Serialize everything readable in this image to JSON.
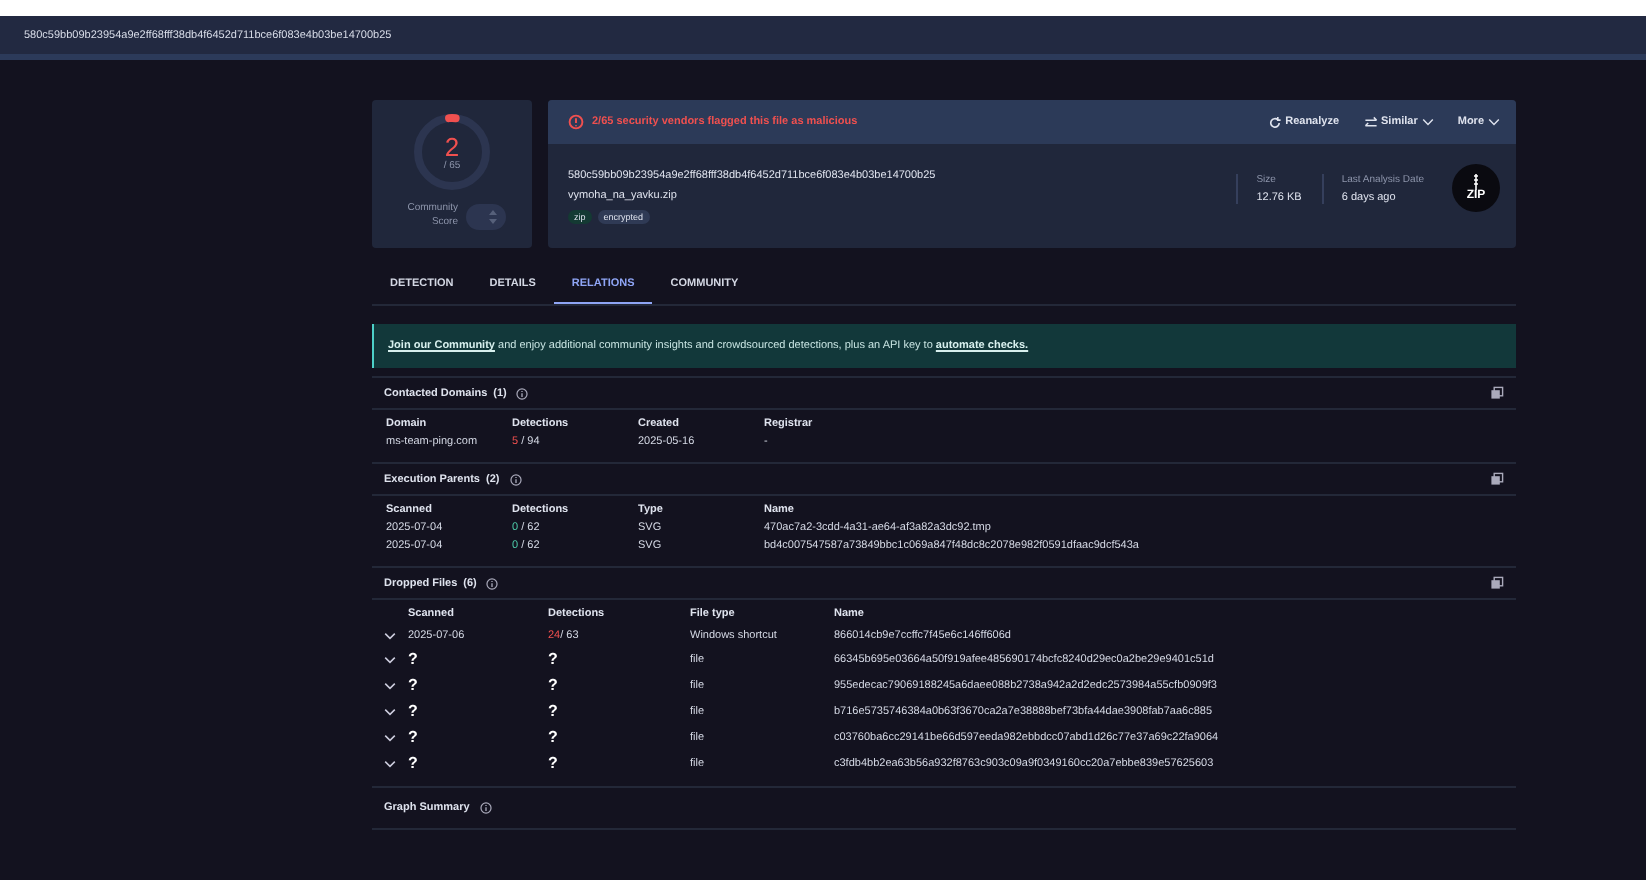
{
  "top_bar": {
    "hash": "580c59bb09b23954a9e2ff68fff38db4f6452d711bce6f083e4b03be14700b25"
  },
  "score": {
    "value": "2",
    "total": "/ 65",
    "label": "Community Score"
  },
  "alert": {
    "text": "2/65 security vendors flagged this file as malicious"
  },
  "actions": [
    {
      "label": "Reanalyze",
      "kind": "reanalyze"
    },
    {
      "label": "Similar",
      "kind": "similar"
    },
    {
      "label": "More",
      "kind": "more"
    }
  ],
  "file": {
    "hash": "580c59bb09b23954a9e2ff68fff38db4f6452d711bce6f083e4b03be14700b25",
    "name": "vymoha_na_yavku.zip",
    "tags": [
      {
        "label": "zip",
        "color": "#143a33"
      },
      {
        "label": "encrypted",
        "color": "#2f3a55"
      }
    ],
    "size_label": "Size",
    "size": "12.76 KB",
    "date_label": "Last Analysis Date",
    "date": "6 days ago",
    "type": "ZIP"
  },
  "tabs": [
    {
      "label": "DETECTION",
      "selected": false
    },
    {
      "label": "DETAILS",
      "selected": false
    },
    {
      "label": "RELATIONS",
      "selected": true
    },
    {
      "label": "COMMUNITY",
      "selected": false
    }
  ],
  "banner": {
    "link": "Join our Community",
    "text": " and enjoy additional community insights and crowdsourced detections, plus an API key to ",
    "link2": "automate checks."
  },
  "contacted_domains": {
    "title": "Contacted Domains",
    "count": "(1)",
    "columns": [
      "Domain",
      "Detections",
      "Created",
      "Registrar"
    ],
    "rows": [
      {
        "domain": "ms-team-ping.com",
        "hits": "5",
        "total": "/ 94",
        "flagged": true,
        "created": "2025-05-16",
        "registrar": "-"
      }
    ]
  },
  "execution_parents": {
    "title": "Execution Parents",
    "count": "(2)",
    "columns": [
      "Scanned",
      "Detections",
      "Type",
      "Name"
    ],
    "rows": [
      {
        "scanned": "2025-07-04",
        "hits": "0",
        "total": "/ 62",
        "flagged": false,
        "type": "SVG",
        "name": "470ac7a2-3cdd-4a31-ae64-af3a82a3dc92.tmp"
      },
      {
        "scanned": "2025-07-04",
        "hits": "0",
        "total": "/ 62",
        "flagged": false,
        "type": "SVG",
        "name": "bd4c007547587a73849bbc1c069a847f48dc8c2078e982f0591dfaac9dcf543a"
      }
    ]
  },
  "dropped_files": {
    "title": "Dropped Files",
    "count": "(6)",
    "columns": [
      "Scanned",
      "Detections",
      "File type",
      "Name"
    ],
    "rows": [
      {
        "scanned": "2025-07-06",
        "hits": "24",
        "total": "/ 63",
        "flagged": true,
        "type": "Windows shortcut",
        "name": "866014cb9e7ccffc7f45e6c146ff606d"
      },
      {
        "scanned": "?",
        "hits": "?",
        "type": "file",
        "name": "66345b695e03664a50f919afee485690174bcfc8240d29ec0a2be29e9401c51d"
      },
      {
        "scanned": "?",
        "hits": "?",
        "type": "file",
        "name": "955edecac79069188245a6daee088b2738a942a2d2edc2573984a55cfb0909f3"
      },
      {
        "scanned": "?",
        "hits": "?",
        "type": "file",
        "name": "b716e5735746384a0b63f3670ca2a7e38888bef73bfa44dae3908fab7aa6c885"
      },
      {
        "scanned": "?",
        "hits": "?",
        "type": "file",
        "name": "c03760ba6cc29141be66d597eeda982ebbdcc07abd1d26c77e37a69c22fa9064"
      },
      {
        "scanned": "?",
        "hits": "?",
        "type": "file",
        "name": "c3fdb4bb2ea63b56a932f8763c903c09a9f0349160cc20a7ebbe839e57625603"
      }
    ]
  },
  "graph_summary": {
    "title": "Graph Summary"
  }
}
